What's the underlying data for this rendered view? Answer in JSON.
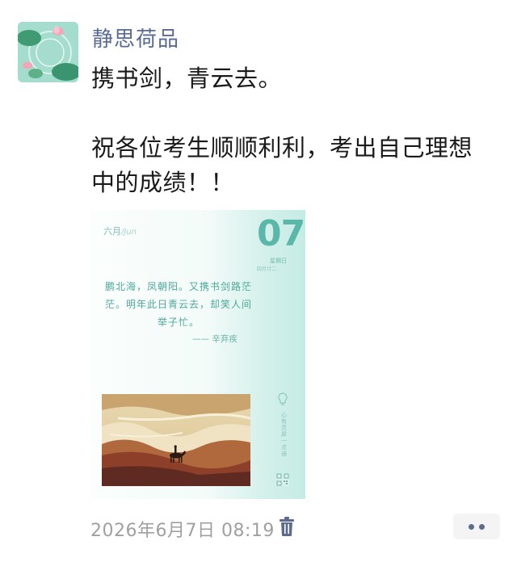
{
  "post": {
    "author": "静思荷品",
    "text": "携书剑，青云去。\n\n祝各位考生顺顺利利，考出自己理想中的成绩！！",
    "timestamp": "2026年6月7日 08:19"
  },
  "calendar_card": {
    "month": "六月",
    "month_en": "/Jun",
    "day": "07",
    "weekday": "星期日",
    "lunar": "四月廿二",
    "poem": "鹏北海，凤朝阳。又携书剑路茫茫。明年此日青云去，却笑人间举子忙。",
    "author": "—— 辛弃疾",
    "side_text": "心有灵犀一点通",
    "accent": "#5ab8aa"
  },
  "icons": {
    "delete": "trash-icon",
    "more": "more-dots-icon",
    "lightbulb": "lightbulb-icon",
    "qr": "qr-code-icon"
  }
}
